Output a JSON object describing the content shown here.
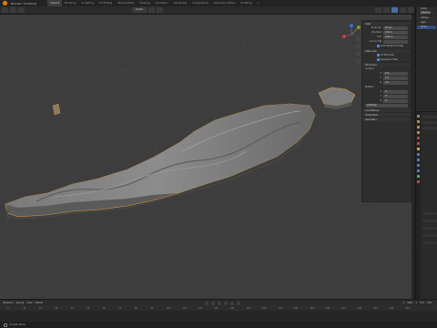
{
  "app": {
    "title": "Blender* [Untitled]"
  },
  "workspaces": [
    "Layout",
    "Modeling",
    "Sculpting",
    "UV Editing",
    "Texture Paint",
    "Shading",
    "Animation",
    "Rendering",
    "Compositing",
    "Geometry Nodes",
    "Scripting",
    "+"
  ],
  "active_workspace_index": 0,
  "viewport_header": {
    "shading_mode": "Global"
  },
  "npanel": {
    "sections": {
      "view": "View",
      "view_lock": "View Lock",
      "cursor_3d": "3D Cursor",
      "annotations": "Annotations",
      "collections": "Collections",
      "geometry": "Geometry"
    },
    "rows": [
      {
        "label": "Focal Len",
        "value": "50 mm"
      },
      {
        "label": "Clip Start",
        "value": "0.01 m"
      },
      {
        "label": "End",
        "value": "1000 m"
      },
      {
        "label": "Lock to Obj",
        "value": ""
      },
      {
        "label": "X",
        "value": "0 m"
      },
      {
        "label": "Y",
        "value": "0 m"
      },
      {
        "label": "Z",
        "value": "0 m"
      },
      {
        "label": "X",
        "value": "0°"
      },
      {
        "label": "Y",
        "value": "0°"
      },
      {
        "label": "Z",
        "value": "0°"
      }
    ],
    "checks": [
      "Lock Camera to View",
      "To 3D Cursor",
      "Camera to View"
    ],
    "rotation_label": "Rotation",
    "location_label": "Location",
    "xyz_euler": "XYZ Euler"
  },
  "timeline": {
    "playback": "Playback",
    "keying": "Keying",
    "view": "View",
    "marker": "Marker",
    "start_label": "Start",
    "start_value": "1",
    "end_label": "End",
    "end_value": "250",
    "current_frame": "1",
    "ticks": [
      "0",
      "10",
      "20",
      "30",
      "40",
      "50",
      "60",
      "70",
      "80",
      "90",
      "100",
      "110",
      "120",
      "130",
      "140",
      "150",
      "160",
      "170",
      "180",
      "190",
      "200",
      "210",
      "220",
      "230",
      "240",
      "250"
    ]
  },
  "status": {
    "text": "Context Menu"
  },
  "outliner": {
    "rows": [
      "Scene Collection",
      "Collection",
      "Camera",
      "Light",
      "terrain"
    ]
  },
  "colors": {
    "accent": "#e87d0d",
    "selection": "#334d80",
    "viewport": "#3d3d3d",
    "mesh": "#6e6e6e"
  }
}
